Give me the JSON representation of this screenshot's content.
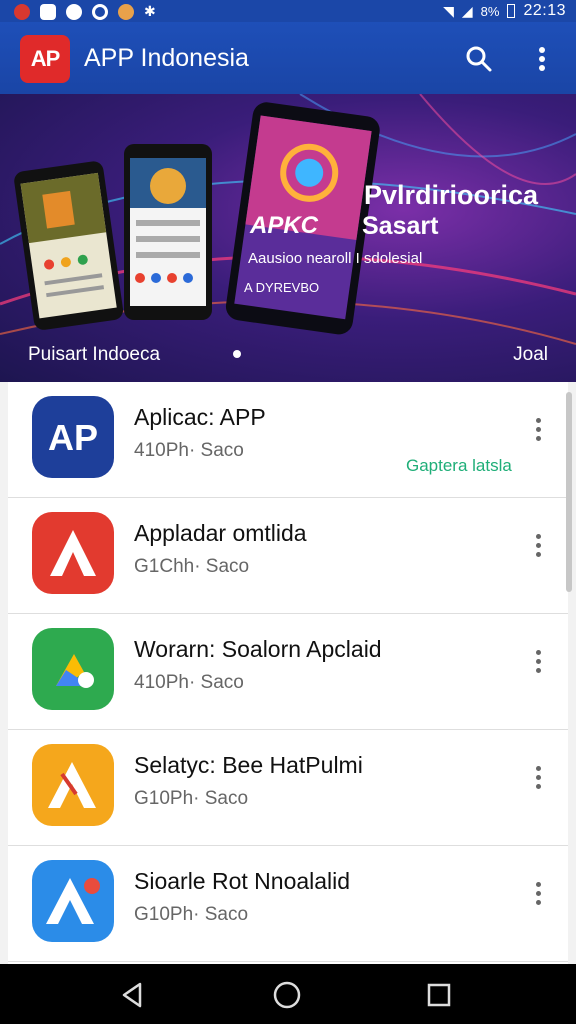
{
  "status_bar": {
    "time": "22:13",
    "battery_text": "8%",
    "icons": [
      "notification-icon",
      "photo-icon",
      "media-icon",
      "sync-icon",
      "cat-icon",
      "bluetooth-icon",
      "wifi-icon",
      "signal-icon",
      "battery-icon"
    ]
  },
  "app_bar": {
    "logo_text": "AP",
    "title": "APP Indonesia",
    "search_icon": "search-icon",
    "more_icon": "more-vert-icon"
  },
  "banner": {
    "headline_1": "Pvlrdirioorica",
    "headline_2": "Sasart",
    "brand": "APKC",
    "subline": "Aausioo nearoll I sdolesial",
    "tagline": "A DYREVBO",
    "bottom_left": "Puisart Indoeca",
    "bottom_right": "Joal"
  },
  "apps": [
    {
      "title": "Aplicac: APP",
      "subtitle": "410Ph· Saco",
      "icon": "ap-logo-icon",
      "color": "#1e3f9a"
    },
    {
      "title": "Appladar omtlida",
      "subtitle": "G1Chh· Saco",
      "icon": "red-a-icon",
      "color": "#e23a2f"
    },
    {
      "title": "Worarn: Soalorn Apclaid",
      "subtitle": "410Ph· Saco",
      "icon": "drive-icon",
      "color": "#2eaa4f"
    },
    {
      "title": "Selatyc: Bee HatPulmi",
      "subtitle": "G10Ph· Saco",
      "icon": "orange-a-icon",
      "color": "#f5a71c"
    },
    {
      "title": "Sioarle Rot Nnoalalid",
      "subtitle": "G10Ph· Saco",
      "icon": "blue-a-icon",
      "color": "#2b8ce8"
    }
  ],
  "side_label": "Gaptera latsla",
  "nav": {
    "back": "back-icon",
    "home": "home-icon",
    "recents": "recents-icon"
  }
}
